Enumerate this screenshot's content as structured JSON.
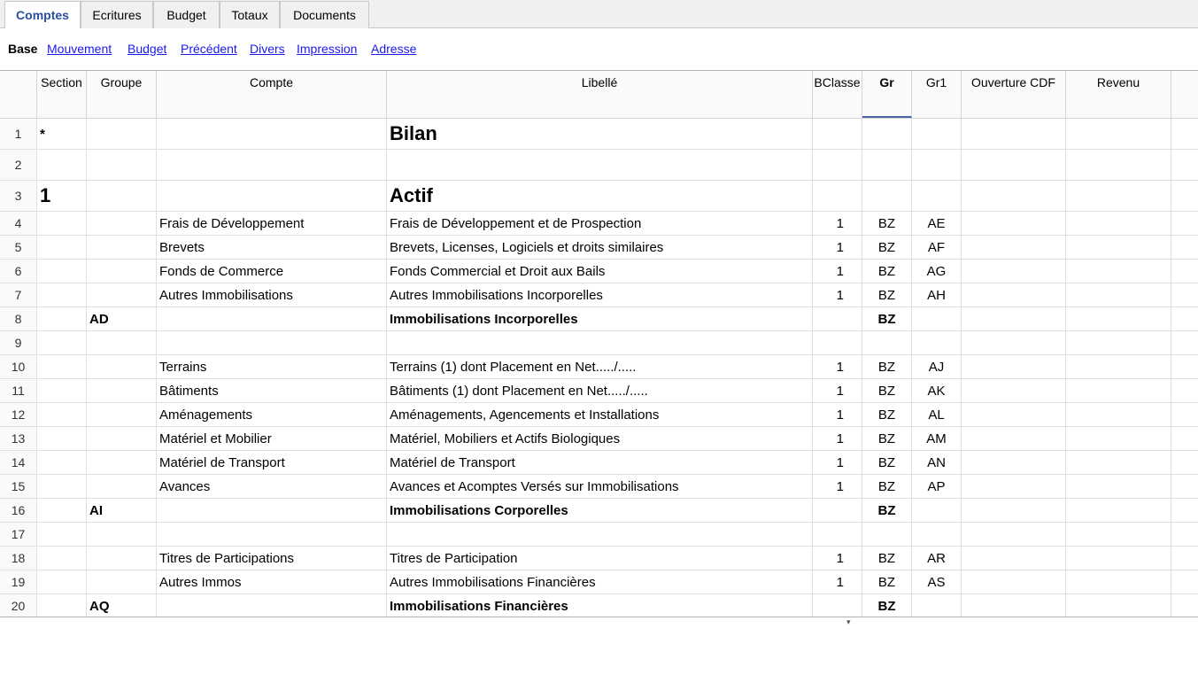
{
  "tabs": [
    "Comptes",
    "Ecritures",
    "Budget",
    "Totaux",
    "Documents"
  ],
  "subtabs": [
    "Base",
    "Mouvement",
    "Budget",
    "Précédent",
    "Divers",
    "Impression",
    "Adresse"
  ],
  "columns": [
    "Section",
    "Groupe",
    "Compte",
    "Libellé",
    "BClasse",
    "Gr",
    "Gr1",
    "Ouverture CDF",
    "Revenu"
  ],
  "rows": [
    {
      "n": "1",
      "section": "*",
      "groupe": "",
      "compte": "",
      "libelle": "Bilan",
      "bclasse": "",
      "gr": "",
      "gr1": "",
      "style": "title"
    },
    {
      "n": "2",
      "section": "",
      "groupe": "",
      "compte": "",
      "libelle": "",
      "bclasse": "",
      "gr": "",
      "gr1": "",
      "style": "normal"
    },
    {
      "n": "3",
      "section": "1",
      "groupe": "",
      "compte": "",
      "libelle": "Actif",
      "bclasse": "",
      "gr": "",
      "gr1": "",
      "style": "title"
    },
    {
      "n": "4",
      "section": "",
      "groupe": "",
      "compte": "Frais de Développement",
      "libelle": "Frais de Développement et de Prospection",
      "bclasse": "1",
      "gr": "BZ",
      "gr1": "AE",
      "style": "normal"
    },
    {
      "n": "5",
      "section": "",
      "groupe": "",
      "compte": "Brevets",
      "libelle": "Brevets, Licenses, Logiciels et droits similaires",
      "bclasse": "1",
      "gr": "BZ",
      "gr1": "AF",
      "style": "normal"
    },
    {
      "n": "6",
      "section": "",
      "groupe": "",
      "compte": "Fonds de Commerce",
      "libelle": "Fonds Commercial et Droit aux Bails",
      "bclasse": "1",
      "gr": "BZ",
      "gr1": "AG",
      "style": "normal"
    },
    {
      "n": "7",
      "section": "",
      "groupe": "",
      "compte": "Autres Immobilisations",
      "libelle": "Autres Immobilisations Incorporelles",
      "bclasse": "1",
      "gr": "BZ",
      "gr1": "AH",
      "style": "normal"
    },
    {
      "n": "8",
      "section": "",
      "groupe": "AD",
      "compte": "",
      "libelle": "Immobilisations Incorporelles",
      "bclasse": "",
      "gr": "BZ",
      "gr1": "",
      "style": "group"
    },
    {
      "n": "9",
      "section": "",
      "groupe": "",
      "compte": "",
      "libelle": "",
      "bclasse": "",
      "gr": "",
      "gr1": "",
      "style": "normal"
    },
    {
      "n": "10",
      "section": "",
      "groupe": "",
      "compte": "Terrains",
      "libelle": "Terrains (1) dont Placement en Net...../.....",
      "bclasse": "1",
      "gr": "BZ",
      "gr1": "AJ",
      "style": "normal"
    },
    {
      "n": "11",
      "section": "",
      "groupe": "",
      "compte": "Bâtiments",
      "libelle": "Bâtiments (1) dont Placement en Net...../.....",
      "bclasse": "1",
      "gr": "BZ",
      "gr1": "AK",
      "style": "normal"
    },
    {
      "n": "12",
      "section": "",
      "groupe": "",
      "compte": "Aménagements",
      "libelle": "Aménagements, Agencements et Installations",
      "bclasse": "1",
      "gr": "BZ",
      "gr1": "AL",
      "style": "normal"
    },
    {
      "n": "13",
      "section": "",
      "groupe": "",
      "compte": "Matériel et Mobilier",
      "libelle": "Matériel, Mobiliers et Actifs Biologiques",
      "bclasse": "1",
      "gr": "BZ",
      "gr1": "AM",
      "style": "normal"
    },
    {
      "n": "14",
      "section": "",
      "groupe": "",
      "compte": "Matériel de Transport",
      "libelle": "Matériel de Transport",
      "bclasse": "1",
      "gr": "BZ",
      "gr1": "AN",
      "style": "normal"
    },
    {
      "n": "15",
      "section": "",
      "groupe": "",
      "compte": "Avances",
      "libelle": "Avances et Acomptes Versés sur Immobilisations",
      "bclasse": "1",
      "gr": "BZ",
      "gr1": "AP",
      "style": "normal"
    },
    {
      "n": "16",
      "section": "",
      "groupe": "AI",
      "compte": "",
      "libelle": "Immobilisations Corporelles",
      "bclasse": "",
      "gr": "BZ",
      "gr1": "",
      "style": "group"
    },
    {
      "n": "17",
      "section": "",
      "groupe": "",
      "compte": "",
      "libelle": "",
      "bclasse": "",
      "gr": "",
      "gr1": "",
      "style": "normal"
    },
    {
      "n": "18",
      "section": "",
      "groupe": "",
      "compte": "Titres de Participations",
      "libelle": "Titres de Participation",
      "bclasse": "1",
      "gr": "BZ",
      "gr1": "AR",
      "style": "normal"
    },
    {
      "n": "19",
      "section": "",
      "groupe": "",
      "compte": "Autres Immos",
      "libelle": "Autres Immobilisations Financières",
      "bclasse": "1",
      "gr": "BZ",
      "gr1": "AS",
      "style": "normal"
    },
    {
      "n": "20",
      "section": "",
      "groupe": "AQ",
      "compte": "",
      "libelle": "Immobilisations Financières",
      "bclasse": "",
      "gr": "BZ",
      "gr1": "",
      "style": "group"
    }
  ]
}
